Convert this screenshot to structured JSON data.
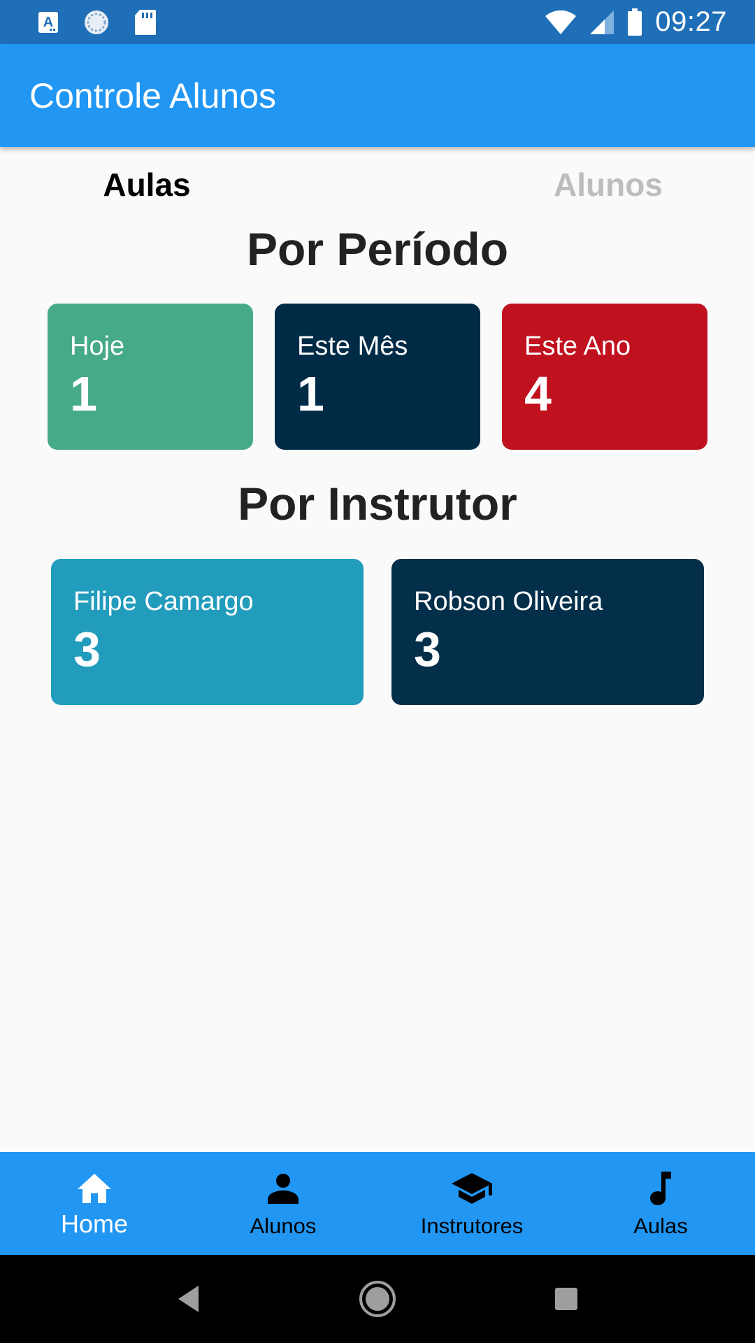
{
  "status_bar": {
    "time": "09:27",
    "icons": [
      "font-a-icon",
      "sync-icon",
      "sd-card-icon",
      "wifi-icon",
      "signal-icon",
      "battery-icon"
    ]
  },
  "app_bar": {
    "title": "Controle Alunos"
  },
  "tabs": [
    {
      "label": "Aulas",
      "active": true
    },
    {
      "label": "Alunos",
      "active": false
    }
  ],
  "period": {
    "title": "Por Período",
    "cards": [
      {
        "label": "Hoje",
        "value": "1",
        "color": "#46a98a"
      },
      {
        "label": "Este Mês",
        "value": "1",
        "color": "#002b46"
      },
      {
        "label": "Este Ano",
        "value": "4",
        "color": "#c0111f"
      }
    ]
  },
  "instructor": {
    "title": "Por Instrutor",
    "cards": [
      {
        "label": "Filipe Camargo",
        "value": "3",
        "color": "#229cbc"
      },
      {
        "label": "Robson Oliveira",
        "value": "3",
        "color": "#032f4a"
      }
    ]
  },
  "bottom_nav": {
    "items": [
      {
        "label": "Home",
        "icon": "home-icon",
        "active": true
      },
      {
        "label": "Alunos",
        "icon": "person-icon",
        "active": false
      },
      {
        "label": "Instrutores",
        "icon": "graduation-cap-icon",
        "active": false
      },
      {
        "label": "Aulas",
        "icon": "music-note-icon",
        "active": false
      }
    ]
  },
  "colors": {
    "status_bar": "#1e6fb8",
    "primary": "#2196f3",
    "background": "#fafafa"
  }
}
